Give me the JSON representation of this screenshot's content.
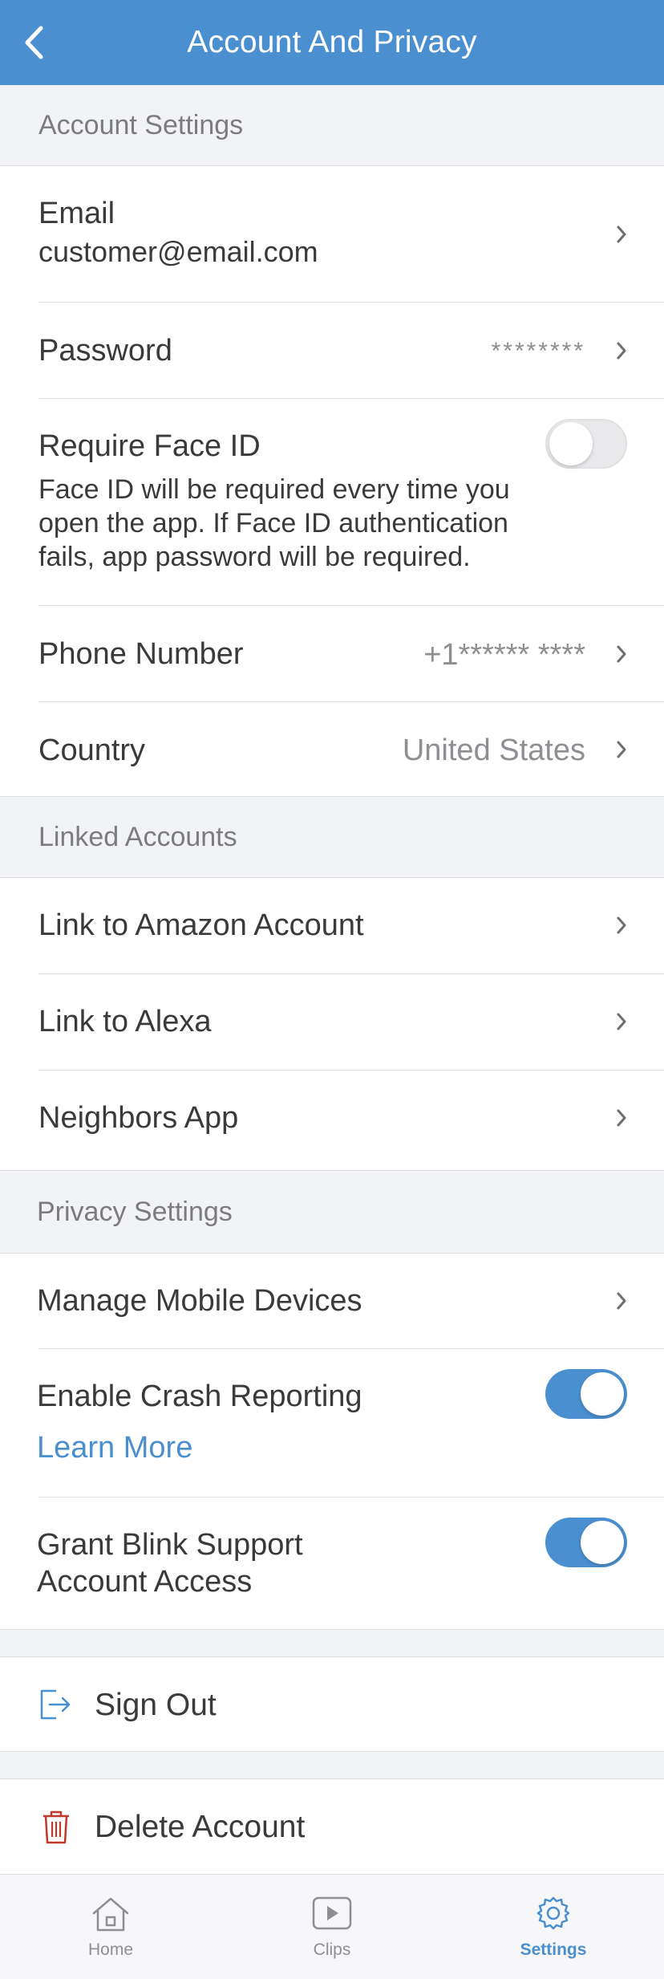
{
  "header": {
    "title": "Account And Privacy",
    "back_icon": "chevron-left-icon"
  },
  "sections": {
    "account": "Account Settings",
    "linked": "Linked Accounts",
    "privacy": "Privacy Settings"
  },
  "account": {
    "email_label": "Email",
    "email_value": "customer@email.com",
    "password_label": "Password",
    "password_value": "********",
    "faceid_label": "Require Face ID",
    "faceid_desc_1": "Face ID will be required every time you",
    "faceid_desc_2": "open the app. If Face ID authentication",
    "faceid_desc_3": "fails, app password will be required.",
    "faceid_enabled": false,
    "phone_label": "Phone Number",
    "phone_value": "+1******  ****",
    "country_label": "Country",
    "country_value": "United States"
  },
  "linked": {
    "amazon": "Link to Amazon Account",
    "alexa": "Link to Alexa",
    "neighbors": "Neighbors App"
  },
  "privacy": {
    "devices": "Manage Mobile Devices",
    "crash_label": "Enable Crash Reporting",
    "crash_enabled": true,
    "learn_more": "Learn More",
    "support_line_1": "Grant Blink Support",
    "support_line_2": "Account Access",
    "support_enabled": true
  },
  "actions": {
    "sign_out": "Sign Out",
    "delete": "Delete Account"
  },
  "tabs": [
    {
      "label": "Home",
      "icon": "home-icon",
      "active": false
    },
    {
      "label": "Clips",
      "icon": "play-icon",
      "active": false
    },
    {
      "label": "Settings",
      "icon": "gear-icon",
      "active": true
    }
  ],
  "colors": {
    "accent": "#4a8fcf",
    "danger": "#c0392b",
    "background": "#f2f3f7"
  }
}
